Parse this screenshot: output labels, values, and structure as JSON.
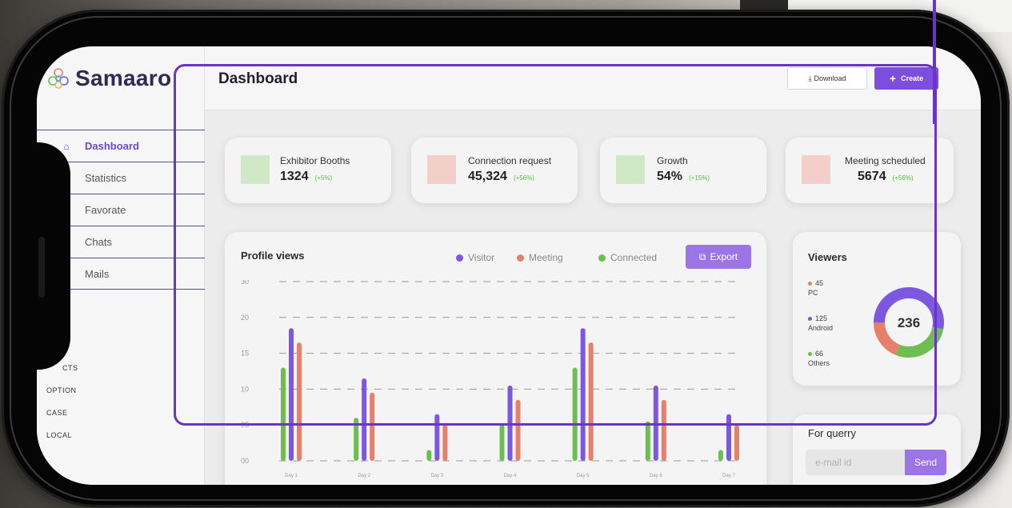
{
  "brand": {
    "name": "Samaaro"
  },
  "header": {
    "title": "Dashboard",
    "download_label": "Download",
    "create_label": "Create"
  },
  "sidebar": {
    "items": [
      {
        "label": "Dashboard",
        "icon": "home-icon",
        "active": true
      },
      {
        "label": "Statistics",
        "icon": "chart-icon"
      },
      {
        "label": "Favorate",
        "icon": "star-icon"
      },
      {
        "label": "Chats",
        "icon": "chat-icon"
      },
      {
        "label": "Mails",
        "icon": "mail-icon"
      }
    ],
    "sub_items": [
      "CTS",
      "OPTION",
      "CASE",
      "LOCAL"
    ]
  },
  "stats": [
    {
      "label": "Exhibitor Booths",
      "value": "1324",
      "delta": "(+5%)",
      "color": "#cfe8c6"
    },
    {
      "label": "Connection request",
      "value": "45,324",
      "delta": "(+56%)",
      "color": "#f2cfc8"
    },
    {
      "label": "Growth",
      "value": "54%",
      "delta": "(+15%)",
      "color": "#cfe8c6"
    },
    {
      "label": "Meeting scheduled",
      "value": "5674",
      "delta": "(+56%)",
      "color": "#f2cfc8"
    }
  ],
  "profile_views": {
    "title": "Profile views",
    "export_label": "Export"
  },
  "chart_data": {
    "type": "bar",
    "categories": [
      "Day 1",
      "Day 2",
      "Day 3",
      "Day 4",
      "Day 5",
      "Day 6",
      "Day 7"
    ],
    "y_ticks": [
      "00",
      "05",
      "10",
      "15",
      "20",
      "30"
    ],
    "ylim": [
      0,
      25
    ],
    "series": [
      {
        "name": "Connected",
        "color": "#6cbf4f",
        "values": [
          13,
          6,
          1.5,
          5,
          13,
          5.5,
          1.5
        ]
      },
      {
        "name": "Visitor",
        "color": "#7c57e0",
        "values": [
          18.5,
          11.5,
          6.5,
          10.5,
          18.5,
          10.5,
          6.5
        ]
      },
      {
        "name": "Meeting",
        "color": "#e6806a",
        "values": [
          16.5,
          9.5,
          5,
          8.5,
          16.5,
          8.5,
          5
        ]
      }
    ],
    "legend": [
      {
        "name": "Visitor",
        "color": "#7c57e0"
      },
      {
        "name": "Meeting",
        "color": "#e6806a"
      },
      {
        "name": "Connected",
        "color": "#6cbf4f"
      }
    ],
    "grid": true
  },
  "viewers": {
    "title": "Viewers",
    "total": "236",
    "items": [
      {
        "value": "45",
        "label": "PC",
        "color": "#e6806a",
        "count": 45
      },
      {
        "value": "125",
        "label": "Android",
        "color": "#7c57e0",
        "count": 125
      },
      {
        "value": "66",
        "label": "Others",
        "color": "#6cbf4f",
        "count": 66
      }
    ]
  },
  "query": {
    "title": "For querry",
    "placeholder": "e-mail id",
    "send_label": "Send"
  }
}
